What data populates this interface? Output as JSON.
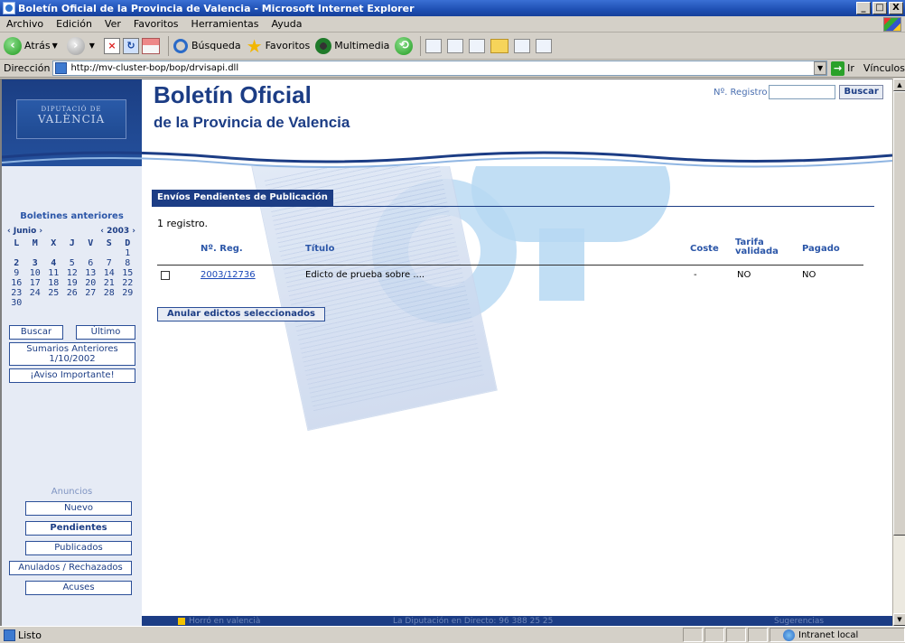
{
  "window": {
    "title": "Boletín Oficial de la Provincia de Valencia - Microsoft Internet Explorer",
    "controls": [
      "_",
      "□",
      "X"
    ]
  },
  "menu": [
    "Archivo",
    "Edición",
    "Ver",
    "Favoritos",
    "Herramientas",
    "Ayuda"
  ],
  "toolbar": {
    "back": "Atrás",
    "search": "Búsqueda",
    "favorites": "Favoritos",
    "multimedia": "Multimedia"
  },
  "address": {
    "label": "Dirección",
    "url": "http://mv-cluster-bop/bop/drvisapi.dll",
    "go": "Ir",
    "links": "Vínculos"
  },
  "header": {
    "logo_line1": "DIPUTACIÓ DE",
    "logo_line2": "VALÈNCIA",
    "title": "Boletín Oficial",
    "subtitle": "de la Provincia de Valencia",
    "registro_label": "Nº. Registro",
    "buscar": "Buscar"
  },
  "sidebar": {
    "title": "Boletines anteriores",
    "month": "‹ Junio ›",
    "year": "‹ 2003 ›",
    "weekdays": [
      "L",
      "M",
      "X",
      "J",
      "V",
      "S",
      "D"
    ],
    "weeks": [
      [
        "",
        "",
        "",
        "",
        "",
        "",
        "1"
      ],
      [
        "2",
        "3",
        "4",
        "5",
        "6",
        "7",
        "8"
      ],
      [
        "9",
        "10",
        "11",
        "12",
        "13",
        "14",
        "15"
      ],
      [
        "16",
        "17",
        "18",
        "19",
        "20",
        "21",
        "22"
      ],
      [
        "23",
        "24",
        "25",
        "26",
        "27",
        "28",
        "29"
      ],
      [
        "30",
        "",
        "",
        "",
        "",
        "",
        ""
      ]
    ],
    "buscar": "Buscar",
    "ultimo": "Último",
    "sumarios_line1": "Sumarios Anteriores",
    "sumarios_line2": "1/10/2002",
    "aviso": "¡Aviso Importante!",
    "anuncios": "Anuncios",
    "nuevo": "Nuevo",
    "pendientes": "Pendientes",
    "publicados": "Publicados",
    "anulados": "Anulados / Rechazados",
    "acuses": "Acuses"
  },
  "content": {
    "tab": "Envíos Pendientes de Publicación",
    "count": "1 registro.",
    "columns": {
      "reg": "Nº. Reg.",
      "titulo": "Título",
      "coste": "Coste",
      "tarifa_1": "Tarifa",
      "tarifa_2": "validada",
      "pagado": "Pagado"
    },
    "row": {
      "reg": "2003/12736",
      "titulo": "Edicto de prueba sobre ....",
      "coste": "-",
      "tarifa": "NO",
      "pagado": "NO"
    },
    "anular_button": "Anular edictos seleccionados"
  },
  "footer": {
    "left": "Horró en valencià",
    "center": "La Diputación en Directo: 96 388 25 25",
    "right": "Sugerencias"
  },
  "status": {
    "text": "Listo",
    "zone": "Intranet local"
  }
}
